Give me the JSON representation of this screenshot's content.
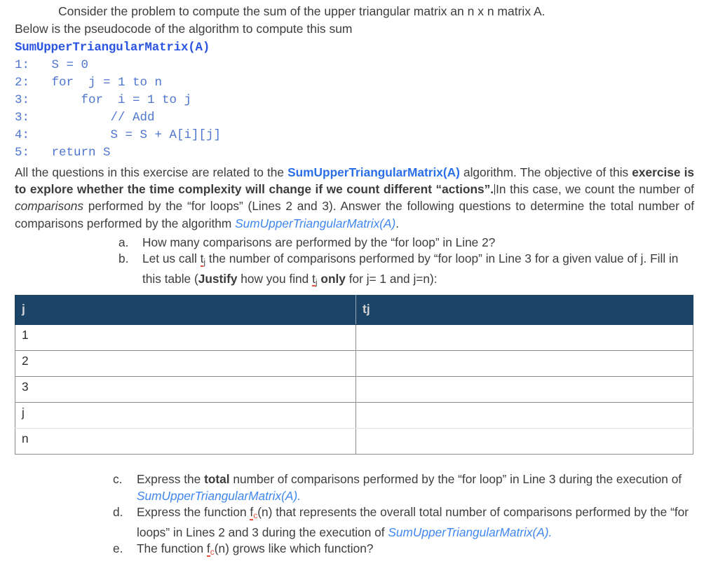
{
  "document": {
    "intro": {
      "line1": "Consider the problem to compute the sum of the upper triangular matrix an n x n matrix A.",
      "line2": "Below is the pseudocode of the algorithm to compute this sum"
    },
    "pseudocode": {
      "title": "SumUpperTriangularMatrix(A)",
      "lines": [
        "1:   S = 0",
        "2:   for  j = 1 to n",
        "3:       for  i = 1 to j",
        "3:           // Add",
        "4:           S = S + A[i][j]",
        "5:   return S"
      ]
    },
    "paragraph": {
      "seg1": "All the questions in this exercise are related to the ",
      "algo_bold": "SumUpperTriangularMatrix(A)",
      "seg2": " algorithm. The objective of this ",
      "bold1": "exercise is to explore whether the time complexity will change if we count different “actions”.",
      "seg3": "In this case, we count the number of ",
      "italic1": "comparisons",
      "seg4": " performed by the “for loops” (Lines 2 and 3). Answer the following questions to determine the total number of comparisons performed by the algorithm ",
      "algo_italic": "SumUpperTriangularMatrix(A)",
      "seg5": "."
    },
    "questions_top": [
      {
        "marker": "a.",
        "text": "How many comparisons are performed by the “for loop” in Line 2?"
      },
      {
        "marker": "b.",
        "seg1": "Let us call ",
        "var_base": "t",
        "var_sub": "j",
        "seg2": " the number of comparisons performed by “for loop” in Line 3 for a given value of j. Fill in this table (",
        "bold1": "Justify",
        "seg3": " how you find ",
        "var2_base": "t",
        "var2_sub": "j",
        "bold2": " only",
        "seg4": " for j= 1 and j=n):"
      }
    ],
    "table": {
      "headers": [
        "j",
        "tj"
      ],
      "rows": [
        {
          "j": "1",
          "tj": ""
        },
        {
          "j": "2",
          "tj": ""
        },
        {
          "j": "3",
          "tj": ""
        },
        {
          "j": "j",
          "tj": ""
        },
        {
          "j": "n",
          "tj": ""
        }
      ]
    },
    "questions_bottom": [
      {
        "marker": "c.",
        "seg1": "Express the ",
        "bold1": "total",
        "seg2": " number of comparisons performed by the “for loop” in Line 3 during the execution of ",
        "algo_italic": "SumUpperTriangularMatrix(A).",
        "seg3": ""
      },
      {
        "marker": "d.",
        "seg1": "Express the function ",
        "var_base": "f",
        "var_sub": "c",
        "seg2": "(n) that represents the overall total number of comparisons performed by the “for loops” in Lines 2 and 3 during the execution of ",
        "algo_italic": "SumUpperTriangularMatrix(A).",
        "seg3": ""
      },
      {
        "marker": "e.",
        "seg1": "The function ",
        "var_base": "f",
        "var_sub": "c",
        "seg2": "(n) grows like which function?",
        "algo_italic": "",
        "seg3": ""
      }
    ],
    "colors": {
      "code_title_blue": "#2b55e0",
      "code_body_blue": "#4f76cf",
      "inline_bold_blue": "#2b6fe8",
      "inline_italic_blue": "#3f86ef",
      "table_header_navy": "#1b4467",
      "table_header_text": "#d4d4d4",
      "spellcheck_red": "#e8503a",
      "body_text": "#3d3d3d"
    }
  }
}
